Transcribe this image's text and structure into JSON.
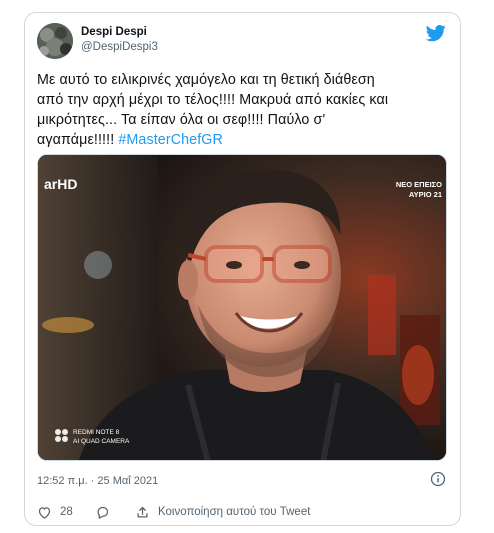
{
  "tweet": {
    "author": {
      "display_name": "Despi Despi",
      "handle": "@DespiDespi3"
    },
    "text_lines": [
      "Με αυτό το ειλικρινές χαμόγελο και τη θετική διάθεση",
      "από την αρχή μέχρι το τέλος!!!! Μακρυά από κακίες και",
      "μικρότητες... Τα είπαν όλα οι σεφ!!!!  Παύλο σ'",
      "αγαπάμε!!!!! "
    ],
    "hashtag": "#MasterChefGR",
    "timestamp": "12:52 π.μ. · 25 Μαΐ 2021",
    "like_count": "28",
    "share_label": "Κοινοποίηση αυτού του Tweet"
  },
  "media_overlay": {
    "channel_logo": "arHD",
    "promo_line1": "ΝΕΟ ΕΠΕΙΣΟ",
    "promo_line2": "ΑΥΡΙΟ 21",
    "watermark_line1": "REDMI NOTE 8",
    "watermark_line2": "AI QUAD CAMERA"
  },
  "icons": {
    "brand": "twitter-bird-icon",
    "info": "info-icon",
    "like": "heart-icon",
    "reply": "reply-bubble-icon",
    "share": "share-upload-icon"
  },
  "colors": {
    "accent": "#1d9bf0",
    "text_primary": "#0f1419",
    "text_secondary": "#536471",
    "border": "#cfd9de"
  }
}
